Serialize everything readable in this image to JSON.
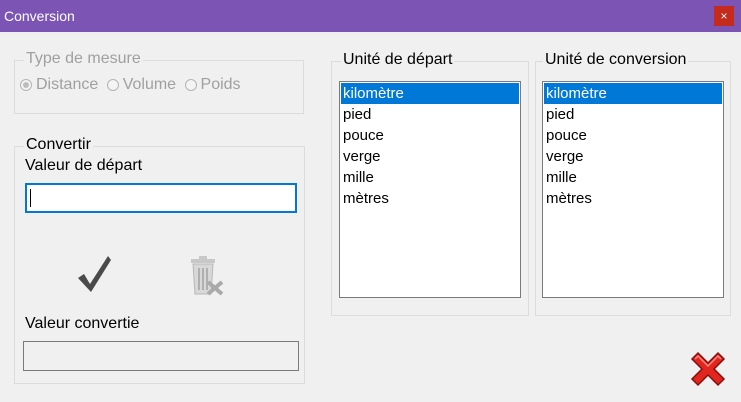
{
  "window": {
    "title": "Conversion",
    "close_glyph": "×"
  },
  "measure_type": {
    "legend": "Type de mesure",
    "options": [
      {
        "label": "Distance",
        "checked": true
      },
      {
        "label": "Volume",
        "checked": false
      },
      {
        "label": "Poids",
        "checked": false
      }
    ]
  },
  "convert": {
    "legend": "Convertir",
    "start_value_label": "Valeur de départ",
    "start_value": "",
    "converted_label": "Valeur convertie",
    "converted_value": ""
  },
  "start_unit": {
    "legend": "Unité de départ",
    "items": [
      "kilomètre",
      "pied",
      "pouce",
      "verge",
      "mille",
      "mètres"
    ],
    "selected": "kilomètre"
  },
  "target_unit": {
    "legend": "Unité de conversion",
    "items": [
      "kilomètre",
      "pied",
      "pouce",
      "verge",
      "mille",
      "mètres"
    ],
    "selected": "kilomètre"
  },
  "icons": {
    "convert": "checkmark-icon",
    "clear": "trash-clear-icon",
    "close": "red-x-close-icon"
  },
  "colors": {
    "titlebar": "#7c55b4",
    "selection": "#0078d7",
    "close_red": "#e0261f"
  }
}
